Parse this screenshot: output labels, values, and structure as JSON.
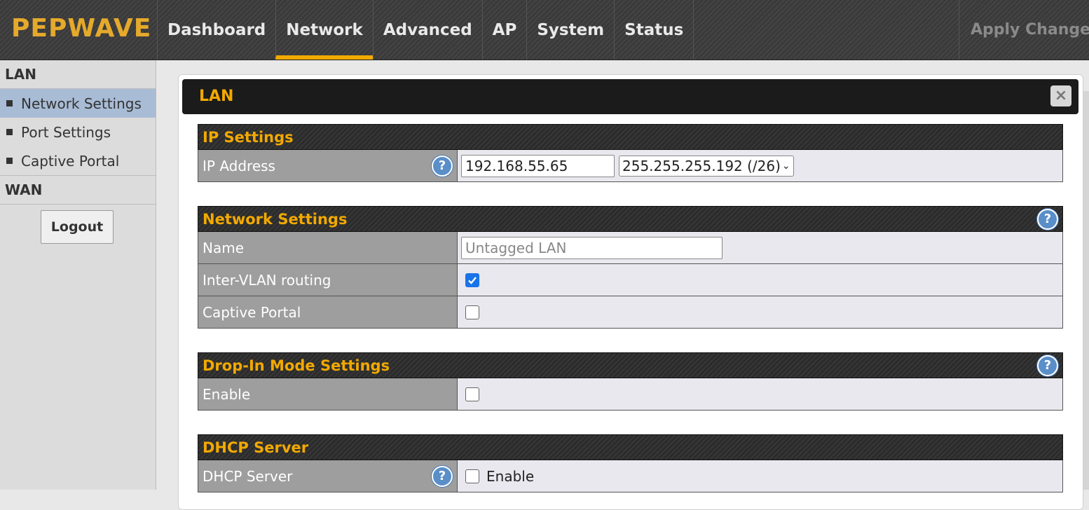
{
  "header": {
    "logo": "PEPWAVE",
    "tabs": [
      "Dashboard",
      "Network",
      "Advanced",
      "AP",
      "System",
      "Status"
    ],
    "active_tab": "Network",
    "apply_label": "Apply Changes"
  },
  "sidebar": {
    "section_lan": "LAN",
    "items": [
      {
        "label": "Network Settings",
        "active": true
      },
      {
        "label": "Port Settings",
        "active": false
      },
      {
        "label": "Captive Portal",
        "active": false
      }
    ],
    "section_wan": "WAN",
    "logout_label": "Logout"
  },
  "dialog": {
    "title": "LAN",
    "close_glyph": "×",
    "ip_settings": {
      "heading": "IP Settings",
      "ip_label": "IP Address",
      "ip_value": "192.168.55.65",
      "mask_value": "255.255.255.192 (/26)"
    },
    "network_settings": {
      "heading": "Network Settings",
      "name_label": "Name",
      "name_placeholder": "Untagged LAN",
      "intervlan_label": "Inter-VLAN routing",
      "intervlan_checked": true,
      "captive_label": "Captive Portal",
      "captive_checked": false
    },
    "dropin": {
      "heading": "Drop-In Mode Settings",
      "enable_label": "Enable",
      "enable_checked": false
    },
    "dhcp": {
      "heading": "DHCP Server",
      "server_label": "DHCP Server",
      "enable_text": "Enable",
      "enable_checked": false
    }
  },
  "colors": {
    "accent": "#f2a900",
    "active_sidebar": "#a9bcd6",
    "checkbox_checked": "#1a73e8"
  }
}
